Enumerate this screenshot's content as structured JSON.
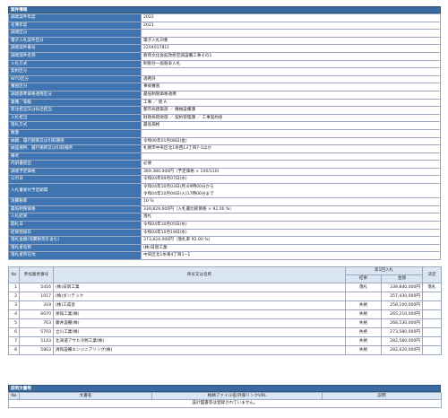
{
  "section_title": "案件情報",
  "info_rows": [
    {
      "label": "調達案件年度",
      "value": "2022"
    },
    {
      "label": "名簿年度",
      "value": "2021"
    },
    {
      "label": "調達区分",
      "value": ""
    },
    {
      "label": "電子入札案件区分",
      "value": "電子入札対象"
    },
    {
      "label": "調達案件番号",
      "value": "2204017811"
    },
    {
      "label": "調達案件名称",
      "value": "教育文化会館改修空調設備工事その1"
    },
    {
      "label": "入札方式",
      "value": "制限付一般競争入札"
    },
    {
      "label": "契約区分",
      "value": ""
    },
    {
      "label": "WTO区分",
      "value": "適用外"
    },
    {
      "label": "審査区分",
      "value": "事後審査"
    },
    {
      "label": "調達基準価格適用区分",
      "value": "最低制限価格適用"
    },
    {
      "label": "業種／等級",
      "value": "工事 ／ 管 A"
    },
    {
      "label": "発注担当又は払出担当",
      "value": "都市局建築部 ／ 機械設備課"
    },
    {
      "label": "入札担当",
      "value": "財政局管財部 ／ 契約管理課 ／ 工事契約係"
    },
    {
      "label": "落札方式",
      "value": "最低価格"
    },
    {
      "label": "数量",
      "value": ""
    },
    {
      "label": "納期、履行期限又は引取期限",
      "value": "令和06年01月08日(金)"
    },
    {
      "label": "納品場所、履行場所又は引取場所",
      "value": "札幌市中央区北1条西13丁目7-1ほか"
    },
    {
      "label": "備考",
      "value": ""
    },
    {
      "label": "内訳書提出",
      "value": "必要"
    },
    {
      "label": "調達予定価格",
      "value": "369,380,000円（予定価格 × 100/110）"
    },
    {
      "label": "公示日",
      "value": "令和04年09月07日(水)"
    },
    {
      "label": "入札書受付予定期間",
      "value": "令和04年10月03日(月)09時00分から",
      "value2": "令和04年10月04日(火)17時00分まで"
    },
    {
      "label": "消費税率",
      "value": "10 %"
    },
    {
      "label": "最低制限価格",
      "value": "339,829,600円（入札書比較価格 × 92.00 %）"
    },
    {
      "label": "入札結果",
      "value": "落札"
    },
    {
      "label": "開札日",
      "value": "令和04年10月05日(水)"
    },
    {
      "label": "結果登録日",
      "value": "令和04年10月19日(水)"
    },
    {
      "label": "落札金額(消費税等を含む)",
      "value": "373,824,000円（落札率 92.00 %）"
    },
    {
      "label": "落札者名称",
      "value": "(株)日新工業"
    },
    {
      "label": "落札者所在地",
      "value": "中央区北1条東4丁目1−1"
    }
  ],
  "bids": {
    "headers": {
      "no": "No",
      "reg": "参加業者番号",
      "name": "商号又は名称",
      "round": "第1回入札",
      "result": "結果",
      "amount": "金額",
      "decision": "決定"
    },
    "rows": [
      {
        "no": "1",
        "reg": "5416",
        "name": "(株)日新工業",
        "result": "落札",
        "amount": "339,840,000円",
        "decision": "落札"
      },
      {
        "no": "2",
        "reg": "1017",
        "name": "(株)ダンテック",
        "result": "",
        "amount": "357,430,000円",
        "decision": ""
      },
      {
        "no": "3",
        "reg": "319",
        "name": "(株)工成舎",
        "result": "失格",
        "amount": "258,100,000円",
        "decision": ""
      },
      {
        "no": "4",
        "reg": "6070",
        "name": "栄知工業(株)",
        "result": "失格",
        "amount": "265,210,000円",
        "decision": ""
      },
      {
        "no": "5",
        "reg": "763",
        "name": "藤井設備(株)",
        "result": "失格",
        "amount": "268,530,000円",
        "decision": ""
      },
      {
        "no": "6",
        "reg": "5703",
        "name": "立川工業(株)",
        "result": "失格",
        "amount": "273,580,000円",
        "decision": ""
      },
      {
        "no": "7",
        "reg": "5143",
        "name": "北海道アサヒ冷熱工業(株)",
        "result": "失格",
        "amount": "282,580,000円",
        "decision": ""
      },
      {
        "no": "8",
        "reg": "5803",
        "name": "清和設備エンジニアリング(株)",
        "result": "失格",
        "amount": "282,620,000円",
        "decision": ""
      }
    ]
  },
  "docs": {
    "title": "説明文書等",
    "headers": {
      "no": "No",
      "doc": "文書名",
      "file": "格納ファイル名/外部リンクURL",
      "desc": "説明"
    },
    "empty_message": "設計図書等は登録されていません。"
  }
}
